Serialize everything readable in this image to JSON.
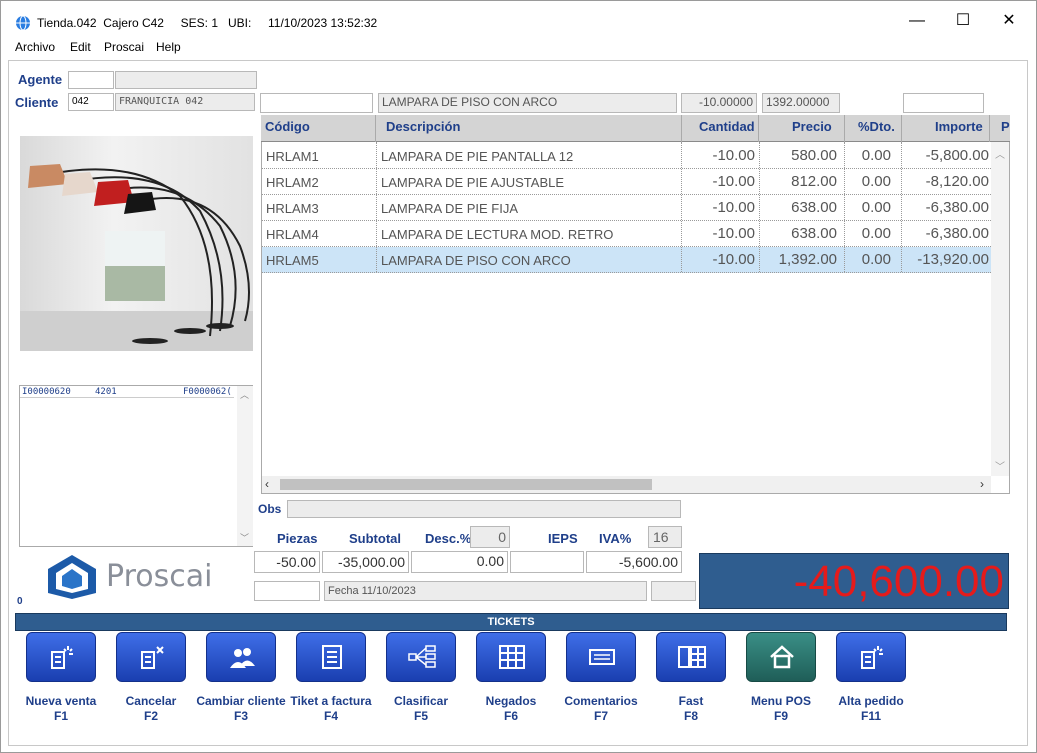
{
  "window": {
    "title": "Tienda.042  Cajero C42     SES: 1   UBI:     11/10/2023 13:52:32",
    "minimize": "—",
    "maximize": "☐",
    "close": "✕"
  },
  "menu": [
    "Archivo",
    "Edit",
    "Proscai",
    "Help"
  ],
  "agente": {
    "label": "Agente",
    "code": "",
    "name": ""
  },
  "cliente": {
    "label": "Cliente",
    "code": "042",
    "name": "FRANQUICIA 042"
  },
  "entry": {
    "code": "",
    "description": "LAMPARA DE PISO CON ARCO",
    "qty": "-10.00000",
    "price": "1392.00000",
    "extra": ""
  },
  "list_box": {
    "col1": "I00000620",
    "col2": "4201",
    "col3": "F0000062("
  },
  "grid": {
    "headers": [
      "Código",
      "Descripción",
      "Cantidad",
      "Precio",
      "%Dto.",
      "Importe",
      "P"
    ],
    "rows": [
      [
        "HRLAM1",
        "LAMPARA DE PIE PANTALLA 12",
        "-10.00",
        "580.00",
        "0.00",
        "-5,800.00"
      ],
      [
        "HRLAM2",
        "LAMPARA DE PIE AJUSTABLE",
        "-10.00",
        "812.00",
        "0.00",
        "-8,120.00"
      ],
      [
        "HRLAM3",
        "LAMPARA DE PIE FIJA",
        "-10.00",
        "638.00",
        "0.00",
        "-6,380.00"
      ],
      [
        "HRLAM4",
        "LAMPARA DE LECTURA MOD. RETRO",
        "-10.00",
        "638.00",
        "0.00",
        "-6,380.00"
      ],
      [
        "HRLAM5",
        "LAMPARA DE PISO CON ARCO",
        "-10.00",
        "1,392.00",
        "0.00",
        "-13,920.00"
      ]
    ],
    "selected_row": 4
  },
  "obs": {
    "label": "Obs",
    "value": ""
  },
  "summary": {
    "piezas_label": "Piezas",
    "subtotal_label": "Subtotal",
    "desc_label": "Desc.%",
    "desc_pct": "0",
    "ieps_label": "IEPS",
    "iva_label": "IVA%",
    "iva_pct": "16",
    "piezas": "-50.00",
    "subtotal": "-35,000.00",
    "descuento": "0.00",
    "ieps": "",
    "iva": "-5,600.00",
    "fecha": "Fecha 11/10/2023"
  },
  "total": "-40,600.00",
  "brand": "Proscai",
  "counter": "0",
  "tickets_bar": "TICKETS",
  "function_buttons": [
    {
      "label": "Nueva venta",
      "key": "F1"
    },
    {
      "label": "Cancelar",
      "key": "F2"
    },
    {
      "label": "Cambiar cliente",
      "key": "F3"
    },
    {
      "label": "Tiket a factura",
      "key": "F4"
    },
    {
      "label": "Clasificar",
      "key": "F5"
    },
    {
      "label": "Negados",
      "key": "F6"
    },
    {
      "label": "Comentarios",
      "key": "F7"
    },
    {
      "label": "Fast",
      "key": "F8"
    },
    {
      "label": "Menu POS",
      "key": "F9"
    },
    {
      "label": "Alta pedido",
      "key": "F11"
    }
  ],
  "colors": {
    "accent": "#1f3f8a",
    "bar": "#2f5d8f",
    "total_text": "#e51b1b",
    "selection": "#cce4f7"
  }
}
